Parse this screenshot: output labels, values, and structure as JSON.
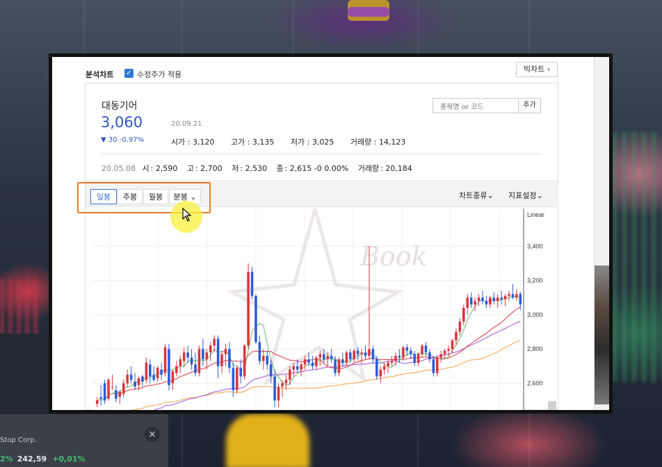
{
  "app": {
    "title": "분석차트",
    "checkbox_label": "수정주가 적용",
    "big_chart_label": "빅차트 ›"
  },
  "stock": {
    "name": "대동기어",
    "price": "3,060",
    "change": "▼ 30 -0.97%",
    "date": "20.09.21",
    "open_label": "시가",
    "open": "3,120",
    "high_label": "고가",
    "high": "3,135",
    "low_label": "저가",
    "low": "3,025",
    "volume_label": "거래량",
    "volume": "14,123"
  },
  "search": {
    "placeholder": "종목명 or 코드",
    "add_label": "추가"
  },
  "history": {
    "date": "20.05.08",
    "o_label": "시",
    "o": "2,590",
    "h_label": "고",
    "h": "2,700",
    "l_label": "저",
    "l": "2,530",
    "c_label": "종",
    "c": "2,615 -0 0.00%",
    "v_label": "거래량",
    "v": "20,184"
  },
  "toolbar": {
    "periods": [
      "일봉",
      "주봉",
      "월봉",
      "분봉 ⌄"
    ],
    "active_period": "일봉",
    "chart_type": "차트종류⌄",
    "indicator_settings": "지표설정⌄"
  },
  "overlay": {
    "close_icon": "×",
    "ticker_name": "Stop Corp.",
    "ticker_pct": "2%",
    "ticker_price": "242,59",
    "ticker_change": "+0,01%"
  },
  "watermark_text": "Book",
  "colors": {
    "up": "#d8363f",
    "down": "#2c5bd6",
    "ma5": "#63b86a",
    "ma20": "#d8363f",
    "ma60": "#a451d6",
    "ma120": "#f0a04a",
    "accent": "#3c6fd1",
    "highlight": "#e87b2b"
  },
  "chart_data": {
    "type": "candlestick",
    "scale_label": "Linear",
    "y_ticks": [
      3400,
      3200,
      3000,
      2800,
      2600
    ],
    "ylim": [
      2440,
      3620
    ],
    "candles": [
      [
        2480,
        2520,
        2460,
        2500
      ],
      [
        2520,
        2590,
        2470,
        2510
      ],
      [
        2600,
        2620,
        2480,
        2500
      ],
      [
        2510,
        2630,
        2500,
        2620
      ],
      [
        2580,
        2650,
        2560,
        2580
      ],
      [
        2560,
        2590,
        2490,
        2510
      ],
      [
        2520,
        2560,
        2480,
        2550
      ],
      [
        2540,
        2620,
        2520,
        2600
      ],
      [
        2600,
        2680,
        2580,
        2650
      ],
      [
        2650,
        2700,
        2600,
        2620
      ],
      [
        2610,
        2660,
        2560,
        2580
      ],
      [
        2590,
        2640,
        2560,
        2630
      ],
      [
        2640,
        2650,
        2580,
        2610
      ],
      [
        2620,
        2750,
        2600,
        2720
      ],
      [
        2710,
        2740,
        2600,
        2640
      ],
      [
        2650,
        2700,
        2610,
        2620
      ],
      [
        2630,
        2700,
        2610,
        2690
      ],
      [
        2680,
        2720,
        2620,
        2650
      ],
      [
        2660,
        2830,
        2640,
        2810
      ],
      [
        2800,
        2830,
        2560,
        2590
      ],
      [
        2600,
        2680,
        2560,
        2670
      ],
      [
        2660,
        2730,
        2640,
        2700
      ],
      [
        2700,
        2760,
        2660,
        2740
      ],
      [
        2730,
        2810,
        2700,
        2780
      ],
      [
        2780,
        2820,
        2720,
        2750
      ],
      [
        2750,
        2800,
        2680,
        2710
      ],
      [
        2710,
        2780,
        2640,
        2660
      ],
      [
        2660,
        2820,
        2640,
        2800
      ],
      [
        2800,
        2860,
        2700,
        2740
      ],
      [
        2740,
        2800,
        2680,
        2780
      ],
      [
        2780,
        2840,
        2730,
        2820
      ],
      [
        2820,
        2880,
        2780,
        2860
      ],
      [
        2860,
        2880,
        2630,
        2700
      ],
      [
        2700,
        2790,
        2660,
        2770
      ],
      [
        2770,
        2830,
        2700,
        2800
      ],
      [
        2800,
        2840,
        2660,
        2690
      ],
      [
        2690,
        2720,
        2520,
        2560
      ],
      [
        2560,
        2700,
        2540,
        2690
      ],
      [
        2690,
        2740,
        2600,
        2640
      ],
      [
        2640,
        2830,
        2620,
        2820
      ],
      [
        2820,
        3300,
        2800,
        3250
      ],
      [
        3250,
        3280,
        3090,
        3110
      ],
      [
        3110,
        3120,
        2830,
        2840
      ],
      [
        2840,
        2880,
        2710,
        2730
      ],
      [
        2730,
        2800,
        2680,
        2760
      ],
      [
        2760,
        2790,
        2680,
        2710
      ],
      [
        2710,
        2740,
        2600,
        2640
      ],
      [
        2640,
        2680,
        2460,
        2500
      ],
      [
        2500,
        2600,
        2460,
        2580
      ],
      [
        2580,
        2620,
        2520,
        2600
      ],
      [
        2600,
        2650,
        2560,
        2620
      ],
      [
        2620,
        2700,
        2590,
        2680
      ],
      [
        2680,
        2720,
        2640,
        2700
      ],
      [
        2700,
        2740,
        2660,
        2680
      ],
      [
        2680,
        2720,
        2640,
        2710
      ],
      [
        2710,
        2760,
        2680,
        2740
      ],
      [
        2740,
        2780,
        2700,
        2720
      ],
      [
        2720,
        2760,
        2680,
        2700
      ],
      [
        2700,
        2760,
        2680,
        2750
      ],
      [
        2750,
        2790,
        2700,
        2770
      ],
      [
        2770,
        2800,
        2720,
        2740
      ],
      [
        2740,
        2780,
        2700,
        2760
      ],
      [
        2760,
        2800,
        2720,
        2740
      ],
      [
        2740,
        2760,
        2640,
        2660
      ],
      [
        2660,
        2750,
        2640,
        2740
      ],
      [
        2740,
        2780,
        2700,
        2720
      ],
      [
        2720,
        2790,
        2700,
        2780
      ],
      [
        2780,
        2800,
        2720,
        2740
      ],
      [
        2740,
        2800,
        2720,
        2790
      ],
      [
        2790,
        2810,
        2740,
        2770
      ],
      [
        2770,
        2800,
        2720,
        2780
      ],
      [
        2780,
        2820,
        2740,
        2760
      ],
      [
        2760,
        3400,
        2740,
        2800
      ],
      [
        2800,
        2820,
        2720,
        2740
      ],
      [
        2740,
        2760,
        2620,
        2640
      ],
      [
        2640,
        2700,
        2600,
        2680
      ],
      [
        2680,
        2720,
        2650,
        2700
      ],
      [
        2700,
        2740,
        2660,
        2720
      ],
      [
        2720,
        2760,
        2700,
        2730
      ],
      [
        2730,
        2780,
        2700,
        2760
      ],
      [
        2760,
        2800,
        2720,
        2750
      ],
      [
        2750,
        2820,
        2730,
        2810
      ],
      [
        2810,
        2830,
        2760,
        2790
      ],
      [
        2790,
        2810,
        2740,
        2770
      ],
      [
        2770,
        2790,
        2700,
        2720
      ],
      [
        2720,
        2780,
        2700,
        2770
      ],
      [
        2770,
        2830,
        2750,
        2820
      ],
      [
        2820,
        2840,
        2760,
        2780
      ],
      [
        2780,
        2800,
        2720,
        2740
      ],
      [
        2740,
        2760,
        2640,
        2660
      ],
      [
        2660,
        2760,
        2640,
        2750
      ],
      [
        2750,
        2790,
        2720,
        2770
      ],
      [
        2770,
        2800,
        2740,
        2790
      ],
      [
        2790,
        2820,
        2760,
        2800
      ],
      [
        2800,
        2860,
        2780,
        2850
      ],
      [
        2850,
        2920,
        2820,
        2900
      ],
      [
        2900,
        2980,
        2880,
        2960
      ],
      [
        2960,
        3060,
        2940,
        3040
      ],
      [
        3040,
        3120,
        3000,
        3100
      ],
      [
        3100,
        3130,
        3040,
        3060
      ],
      [
        3060,
        3100,
        3020,
        3080
      ],
      [
        3080,
        3120,
        3050,
        3100
      ],
      [
        3100,
        3140,
        3060,
        3080
      ],
      [
        3080,
        3110,
        3040,
        3060
      ],
      [
        3060,
        3110,
        3040,
        3100
      ],
      [
        3100,
        3130,
        3060,
        3080
      ],
      [
        3080,
        3120,
        3040,
        3100
      ],
      [
        3100,
        3140,
        3060,
        3090
      ],
      [
        3090,
        3120,
        3050,
        3110
      ],
      [
        3110,
        3140,
        3080,
        3120
      ],
      [
        3120,
        3180,
        3090,
        3100
      ],
      [
        3100,
        3150,
        3080,
        3120
      ],
      [
        3120,
        3135,
        3025,
        3060
      ]
    ]
  }
}
